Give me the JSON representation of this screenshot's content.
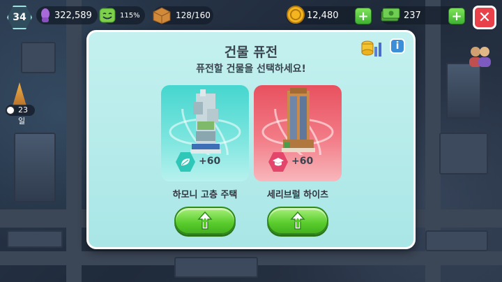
{
  "hud": {
    "level": "34",
    "population": "322,589",
    "happiness": "115%",
    "storage": "128/160",
    "coins": "12,480",
    "cash": "237"
  },
  "event": {
    "days_left": "23일"
  },
  "modal": {
    "title": "건물 퓨전",
    "subtitle": "퓨전할 건물을 선택하세요!",
    "buildings": [
      {
        "name": "하모니 고층 주택",
        "bonus": "+60",
        "theme": "#45d6cf",
        "bonus_icon": "leaf-icon"
      },
      {
        "name": "세리브럴 하이츠",
        "bonus": "+60",
        "theme": "#e8515f",
        "bonus_icon": "graduation-cap-icon"
      }
    ]
  },
  "colors": {
    "accent_green": "#59cc2c",
    "close_red": "#e8414a",
    "modal_bg": "#c4f1ef"
  }
}
